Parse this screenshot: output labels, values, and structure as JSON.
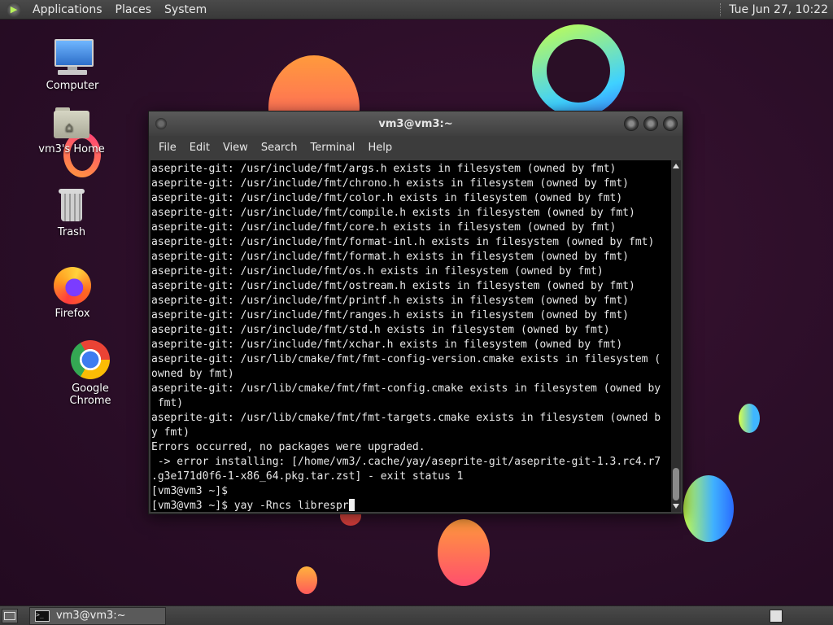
{
  "top_panel": {
    "menus": [
      "Applications",
      "Places",
      "System"
    ],
    "clock": "Tue Jun 27, 10:22"
  },
  "desktop": {
    "icons": [
      {
        "label": "Computer",
        "icon": "computer-icon"
      },
      {
        "label": "vm3's Home",
        "icon": "home-folder-icon"
      },
      {
        "label": "Trash",
        "icon": "trash-icon"
      },
      {
        "label": "Firefox",
        "icon": "firefox-icon"
      },
      {
        "label": "Google Chrome",
        "icon": "chrome-icon"
      }
    ]
  },
  "terminal": {
    "title": "vm3@vm3:~",
    "menu": [
      "File",
      "Edit",
      "View",
      "Search",
      "Terminal",
      "Help"
    ],
    "lines": [
      "aseprite-git: /usr/include/fmt/args.h exists in filesystem (owned by fmt)",
      "aseprite-git: /usr/include/fmt/chrono.h exists in filesystem (owned by fmt)",
      "aseprite-git: /usr/include/fmt/color.h exists in filesystem (owned by fmt)",
      "aseprite-git: /usr/include/fmt/compile.h exists in filesystem (owned by fmt)",
      "aseprite-git: /usr/include/fmt/core.h exists in filesystem (owned by fmt)",
      "aseprite-git: /usr/include/fmt/format-inl.h exists in filesystem (owned by fmt)",
      "aseprite-git: /usr/include/fmt/format.h exists in filesystem (owned by fmt)",
      "aseprite-git: /usr/include/fmt/os.h exists in filesystem (owned by fmt)",
      "aseprite-git: /usr/include/fmt/ostream.h exists in filesystem (owned by fmt)",
      "aseprite-git: /usr/include/fmt/printf.h exists in filesystem (owned by fmt)",
      "aseprite-git: /usr/include/fmt/ranges.h exists in filesystem (owned by fmt)",
      "aseprite-git: /usr/include/fmt/std.h exists in filesystem (owned by fmt)",
      "aseprite-git: /usr/include/fmt/xchar.h exists in filesystem (owned by fmt)",
      "aseprite-git: /usr/lib/cmake/fmt/fmt-config-version.cmake exists in filesystem (",
      "owned by fmt)",
      "aseprite-git: /usr/lib/cmake/fmt/fmt-config.cmake exists in filesystem (owned by",
      " fmt)",
      "aseprite-git: /usr/lib/cmake/fmt/fmt-targets.cmake exists in filesystem (owned b",
      "y fmt)",
      "Errors occurred, no packages were upgraded.",
      " -> error installing: [/home/vm3/.cache/yay/aseprite-git/aseprite-git-1.3.rc4.r7",
      ".g3e171d0f6-1-x86_64.pkg.tar.zst] - exit status 1",
      "[vm3@vm3 ~]$"
    ],
    "prompt_line": "[vm3@vm3 ~]$ yay -Rncs librespr"
  },
  "taskbar": {
    "task_label": "vm3@vm3:~"
  }
}
